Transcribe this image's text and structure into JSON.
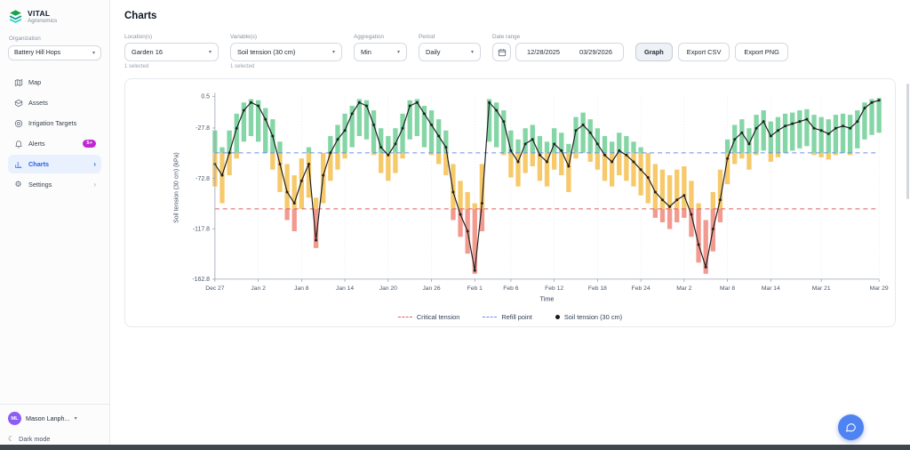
{
  "app": {
    "brand": "VITAL",
    "brand_sub": "Agronomics"
  },
  "sidebar": {
    "org_label": "Organization",
    "org_value": "Battery Hill Hops",
    "items": [
      {
        "label": "Map",
        "icon": "map-icon"
      },
      {
        "label": "Assets",
        "icon": "assets-icon"
      },
      {
        "label": "Irrigation Targets",
        "icon": "target-icon"
      },
      {
        "label": "Alerts",
        "icon": "bell-icon",
        "badge": "5+"
      },
      {
        "label": "Charts",
        "icon": "bar-chart-icon",
        "active": true
      },
      {
        "label": "Settings",
        "icon": "gear-icon"
      }
    ],
    "user": {
      "initials": "ML",
      "name": "Mason Lanph..."
    },
    "dark_mode_label": "Dark mode"
  },
  "header": {
    "title": "Charts"
  },
  "filters": {
    "location": {
      "label": "Location(s)",
      "value": "Garden 16",
      "caption": "1 selected"
    },
    "variable": {
      "label": "Variable(s)",
      "value": "Soil tension (30 cm)",
      "caption": "1 selected"
    },
    "aggregation": {
      "label": "Aggregation",
      "value": "Min"
    },
    "period": {
      "label": "Period",
      "value": "Daily"
    },
    "date_range": {
      "label": "Date range",
      "start": "12/28/2025",
      "end": "03/29/2026"
    },
    "buttons": {
      "graph": "Graph",
      "export_csv": "Export CSV",
      "export_png": "Export PNG"
    }
  },
  "chart_data": {
    "type": "bar",
    "title": "",
    "ylabel": "Soil tension (30 cm)  (kPa)",
    "xlabel": "Time",
    "ylim": [
      -162.8,
      0.5
    ],
    "y_ticks": [
      0.5,
      -27.8,
      -72.8,
      -117.8,
      -162.8
    ],
    "x_ticks": [
      {
        "label": "Dec 27",
        "i": 0
      },
      {
        "label": "Jan 2",
        "i": 6
      },
      {
        "label": "Jan 8",
        "i": 12
      },
      {
        "label": "Jan 14",
        "i": 18
      },
      {
        "label": "Jan 20",
        "i": 24
      },
      {
        "label": "Jan 26",
        "i": 30
      },
      {
        "label": "Feb 1",
        "i": 36
      },
      {
        "label": "Feb 6",
        "i": 41
      },
      {
        "label": "Feb 12",
        "i": 47
      },
      {
        "label": "Feb 18",
        "i": 53
      },
      {
        "label": "Feb 24",
        "i": 59
      },
      {
        "label": "Mar 2",
        "i": 65
      },
      {
        "label": "Mar 8",
        "i": 71
      },
      {
        "label": "Mar 14",
        "i": 77
      },
      {
        "label": "Mar 21",
        "i": 84
      },
      {
        "label": "Mar 29",
        "i": 92
      }
    ],
    "thresholds": {
      "critical_tension": -100,
      "refill_point": -50
    },
    "series": {
      "line_name": "Soil tension (30 cm)",
      "values": [
        -60,
        -70,
        -50,
        -28,
        -12,
        -5,
        -8,
        -20,
        -35,
        -60,
        -85,
        -95,
        -75,
        -60,
        -128,
        -70,
        -50,
        -38,
        -30,
        -15,
        -5,
        -8,
        -25,
        -45,
        -52,
        -42,
        -28,
        -8,
        -5,
        -15,
        -25,
        -35,
        -45,
        -85,
        -105,
        -120,
        -155,
        -95,
        -5,
        -12,
        -22,
        -48,
        -58,
        -42,
        -38,
        -52,
        -58,
        -42,
        -48,
        -62,
        -30,
        -25,
        -32,
        -42,
        -52,
        -58,
        -48,
        -52,
        -58,
        -65,
        -72,
        -85,
        -92,
        -98,
        -92,
        -88,
        -105,
        -132,
        -152,
        -118,
        -92,
        -55,
        -38,
        -32,
        -42,
        -28,
        -22,
        -35,
        -30,
        -26,
        -24,
        -22,
        -20,
        -28,
        -30,
        -33,
        -28,
        -26,
        -28,
        -22,
        -10,
        -5,
        -3
      ],
      "bar_high": [
        -30,
        -45,
        -30,
        -15,
        -5,
        -2,
        -3,
        -10,
        -20,
        -40,
        -60,
        -70,
        -55,
        -45,
        -90,
        -50,
        -35,
        -25,
        -15,
        -8,
        -2,
        -3,
        -12,
        -28,
        -35,
        -28,
        -15,
        -3,
        -2,
        -8,
        -12,
        -20,
        -30,
        -60,
        -75,
        -85,
        -95,
        -60,
        -2,
        -5,
        -12,
        -30,
        -38,
        -28,
        -25,
        -35,
        -40,
        -28,
        -32,
        -42,
        -18,
        -14,
        -20,
        -28,
        -35,
        -40,
        -32,
        -35,
        -40,
        -45,
        -50,
        -60,
        -65,
        -70,
        -65,
        -62,
        -75,
        -95,
        -110,
        -85,
        -65,
        -38,
        -25,
        -20,
        -28,
        -16,
        -12,
        -22,
        -18,
        -15,
        -14,
        -12,
        -11,
        -16,
        -18,
        -20,
        -16,
        -15,
        -16,
        -12,
        -5,
        -2,
        -1
      ],
      "bar_low": [
        -80,
        -95,
        -70,
        -55,
        -40,
        -35,
        -40,
        -50,
        -65,
        -85,
        -110,
        -120,
        -100,
        -90,
        -135,
        -95,
        -75,
        -65,
        -55,
        -45,
        -35,
        -38,
        -52,
        -68,
        -75,
        -68,
        -55,
        -38,
        -35,
        -45,
        -52,
        -60,
        -70,
        -110,
        -125,
        -140,
        -158,
        -120,
        -40,
        -45,
        -52,
        -72,
        -80,
        -68,
        -62,
        -75,
        -80,
        -65,
        -70,
        -85,
        -55,
        -50,
        -58,
        -65,
        -75,
        -80,
        -70,
        -75,
        -80,
        -88,
        -95,
        -108,
        -112,
        -118,
        -112,
        -108,
        -125,
        -148,
        -158,
        -138,
        -112,
        -78,
        -60,
        -55,
        -65,
        -52,
        -48,
        -58,
        -54,
        -50,
        -48,
        -46,
        -44,
        -52,
        -54,
        -56,
        -52,
        -50,
        -52,
        -46,
        -38,
        -34,
        -32
      ]
    },
    "colors": {
      "green": "#85d6a6",
      "yellow": "#f6ca6b",
      "red": "#f39a90",
      "line": "#1f1f1f",
      "critical": "#e05b5b",
      "refill": "#6b8de3",
      "grid": "#dfe4ea",
      "axis": "#9aa3b0",
      "tick_text": "#475569"
    },
    "legend": [
      {
        "label": "Critical tension",
        "swatch": "dashed-red"
      },
      {
        "label": "Refill point",
        "swatch": "dashed-blue"
      },
      {
        "label": "Soil tension (30 cm)",
        "swatch": "dot-black"
      }
    ]
  }
}
